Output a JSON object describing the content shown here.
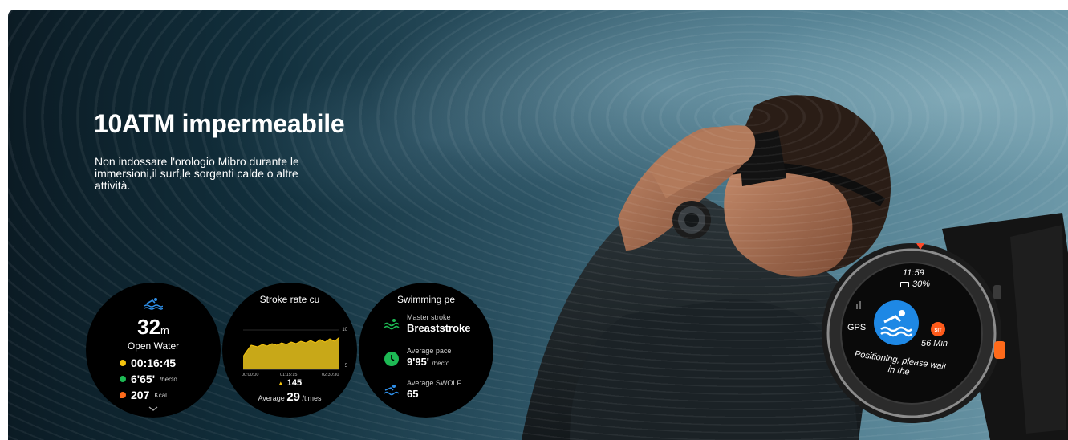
{
  "banner": {
    "headline": "10ATM impermeabile",
    "description": "Non indossare l'orologio Mibro durante le immersioni,il surf,le sorgenti calde o altre attività."
  },
  "watch_faces": {
    "open_water": {
      "distance_value": "32",
      "distance_unit": "m",
      "mode": "Open Water",
      "duration": "00:16:45",
      "pace": "6'65'",
      "pace_unit": "/hecto",
      "calories": "207",
      "calories_unit": "Kcal"
    },
    "stroke_rate": {
      "title": "Stroke rate cu",
      "y_max_label": "10",
      "y_mid_label": "5",
      "x_labels": [
        "00:00:00",
        "01:15:15",
        "02:30:30"
      ],
      "peak": "145",
      "average_label": "Average",
      "average_value": "29",
      "average_unit": "/times"
    },
    "swimming_performance": {
      "title": "Swimming pe",
      "items": [
        {
          "label": "Master stroke",
          "value": "Breaststroke",
          "unit": ""
        },
        {
          "label": "Average pace",
          "value": "9'95'",
          "unit": "/hecto"
        },
        {
          "label": "Average SWOLF",
          "value": "65",
          "unit": ""
        }
      ]
    }
  },
  "product_watch": {
    "time": "11:59",
    "battery": "30%",
    "gps_label": "GPS",
    "sit_badge": "SIT",
    "sit_minutes": "56 Min",
    "message": "Positioning, please wait in the"
  },
  "colors": {
    "gold": "#f5c40e",
    "swim_blue": "#1e88e5",
    "green": "#1db954",
    "orange": "#ff6a1a",
    "pool_blue": "#2f8fe8"
  },
  "icons": {
    "swim": "swim-icon",
    "stopwatch": "stopwatch-icon",
    "pace": "pace-icon",
    "flame": "flame-icon",
    "chevron": "chevron-down-icon",
    "breaststroke": "breaststroke-icon",
    "clock": "clock-icon",
    "swolf": "swolf-icon",
    "battery": "battery-icon"
  }
}
